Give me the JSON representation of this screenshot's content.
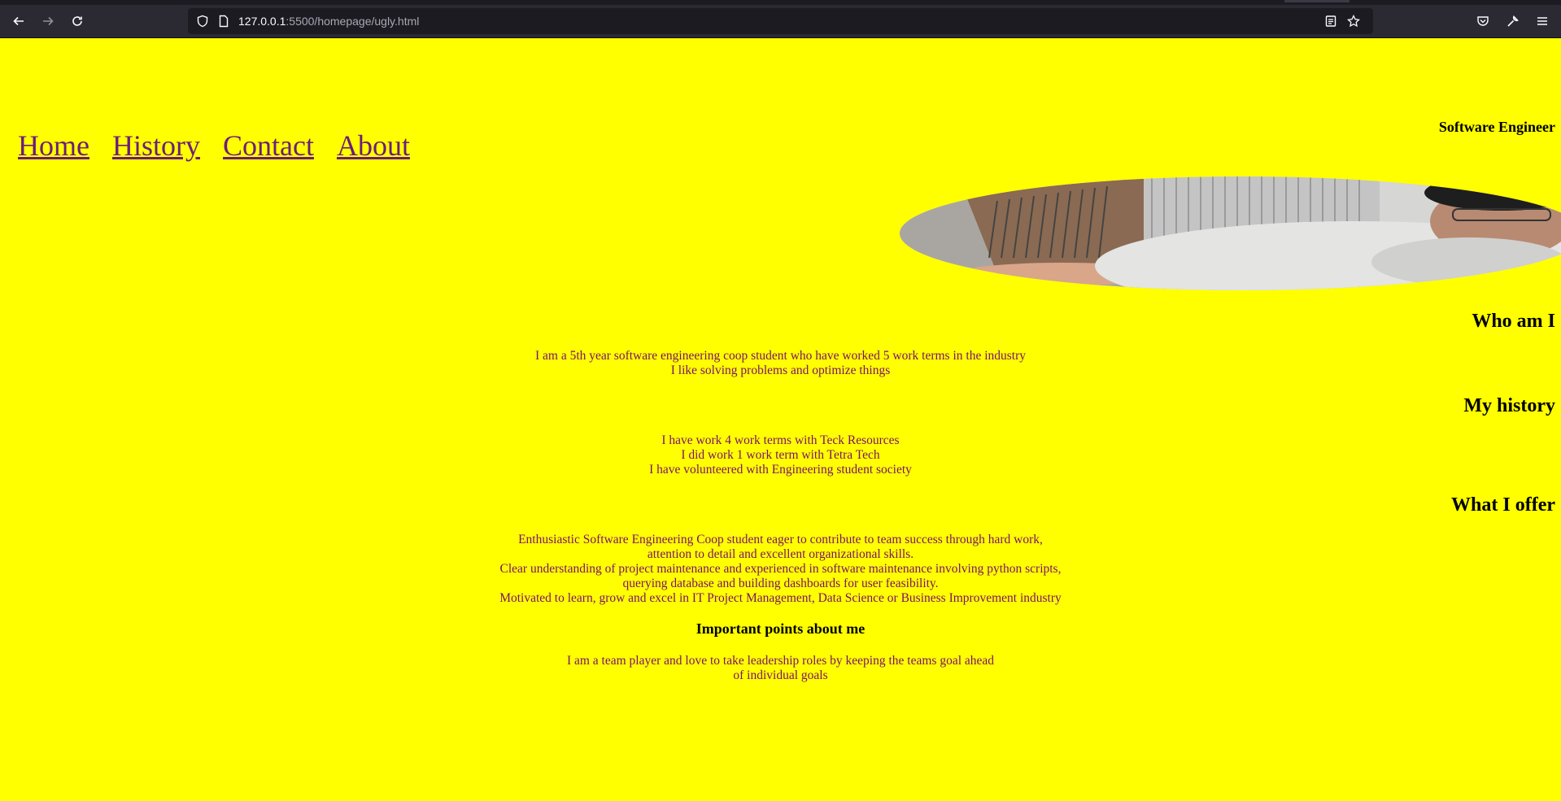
{
  "browser": {
    "url_host": "127.0.0.1",
    "url_rest": ":5500/homepage/ugly.html"
  },
  "nav": {
    "items": [
      "Home",
      "History",
      "Contact",
      "About"
    ]
  },
  "header": {
    "role": "Software Engineer"
  },
  "sections": {
    "who_heading": "Who am I",
    "history_heading": "My history",
    "offer_heading": "What I offer",
    "points_heading": "Important points about me"
  },
  "who_lines": [
    "I am a 5th year software engineering coop student who have worked 5 work terms in the industry",
    "I like solving problems and optimize things"
  ],
  "history_lines": [
    "I have work 4 work terms with Teck Resources",
    "I did work 1 work term with Tetra Tech",
    "I have volunteered with Engineering student society"
  ],
  "offer_lines": [
    "Enthusiastic Software Engineering Coop student eager to contribute to team success through hard work,",
    "attention to detail and excellent organizational skills.",
    "Clear understanding of project maintenance and experienced in software maintenance involving python scripts,",
    "querying database and building dashboards for user feasibility.",
    "Motivated to learn, grow and excel in IT Project Management, Data Science or Business Improvement industry"
  ],
  "points_lines": [
    "I am a team player and love to take leadership roles by keeping the teams goal ahead",
    "of individual goals"
  ],
  "icons": {
    "back": "arrow-left-icon",
    "forward": "arrow-right-icon",
    "reload": "reload-icon",
    "shield": "shield-icon",
    "page": "page-icon",
    "reader": "reader-view-icon",
    "bookmark": "star-icon",
    "pocket": "pocket-icon",
    "tools": "wrench-icon",
    "menu": "hamburger-menu-icon"
  },
  "colors": {
    "page_background": "#ffff00",
    "link": "#6b1d7a",
    "body_text": "#7a1268"
  }
}
